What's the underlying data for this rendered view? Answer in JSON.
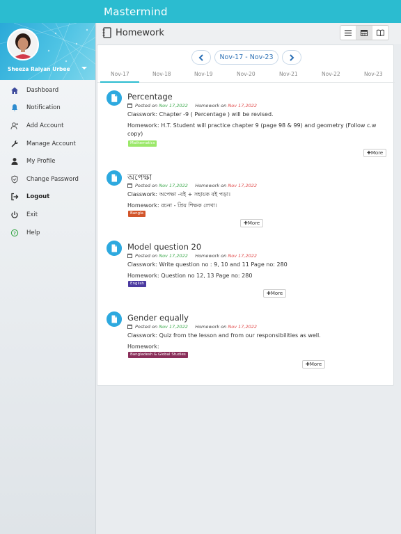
{
  "app": {
    "title": "Mastermind"
  },
  "profile": {
    "name": "Sheeza Raiyan Urbee"
  },
  "nav": [
    {
      "label": "Dashboard",
      "icon": "home-icon",
      "bold": false
    },
    {
      "label": "Notification",
      "icon": "bell-icon",
      "bold": false
    },
    {
      "label": "Add Account",
      "icon": "add-user-icon",
      "bold": false
    },
    {
      "label": "Manage Account",
      "icon": "wrench-icon",
      "bold": false
    },
    {
      "label": "My Profile",
      "icon": "user-icon",
      "bold": false
    },
    {
      "label": "Change Password",
      "icon": "shield-icon",
      "bold": false
    },
    {
      "label": "Logout",
      "icon": "logout-icon",
      "bold": true
    },
    {
      "label": "Exit",
      "icon": "power-icon",
      "bold": false
    },
    {
      "label": "Help",
      "icon": "help-icon",
      "bold": false
    }
  ],
  "header": {
    "title": "Homework",
    "views": [
      "list-view-icon",
      "calendar-view-icon",
      "book-view-icon"
    ]
  },
  "week": {
    "range": "Nov-17 - Nov-23",
    "days": [
      "Nov-17",
      "Nov-18",
      "Nov-19",
      "Nov-20",
      "Nov-21",
      "Nov-22",
      "Nov-23"
    ],
    "selected": 0
  },
  "homework_meta": {
    "posted_label": "Posted on",
    "homework_label": "Homework on"
  },
  "homework": [
    {
      "title": "Percentage",
      "posted": "Nov 17,2022",
      "due": "Nov 17,2022",
      "classwork": "Classwork: Chapter -9 ( Percentage ) will be revised.",
      "homework": "Homework: H.T. Student will practice chapter 9 (page 98 & 99) and geometry (Follow c.w copy)",
      "subject": "Mathematics",
      "subject_color": "#9be86a",
      "more": "More"
    },
    {
      "title": "অপেক্ষা",
      "posted": "Nov 17,2022",
      "due": "Nov 17,2022",
      "classwork": "Classwork: অপেক্ষা -বই + সহায়ক বই পড়া।",
      "homework": "Homework: রচনা - প্রিয় শিক্ষক লেখা।",
      "subject": "Bangla",
      "subject_color": "#d2552b",
      "more": "More"
    },
    {
      "title": "Model question 20",
      "posted": "Nov 17,2022",
      "due": "Nov 17,2022",
      "classwork": "Classwork: Write question no : 9, 10 and 11 Page no: 280",
      "homework": "Homework: Question no 12, 13 Page no: 280",
      "subject": "English",
      "subject_color": "#4b3aa0",
      "more": "More"
    },
    {
      "title": "Gender equally",
      "posted": "Nov 17,2022",
      "due": "Nov 17,2022",
      "classwork": "Classwork: Quiz from the lesson and from our responsibilities as well.",
      "homework": "Homework:",
      "subject": "Bangladesh & Global Studies",
      "subject_color": "#8a2f5a",
      "more": "More"
    }
  ]
}
